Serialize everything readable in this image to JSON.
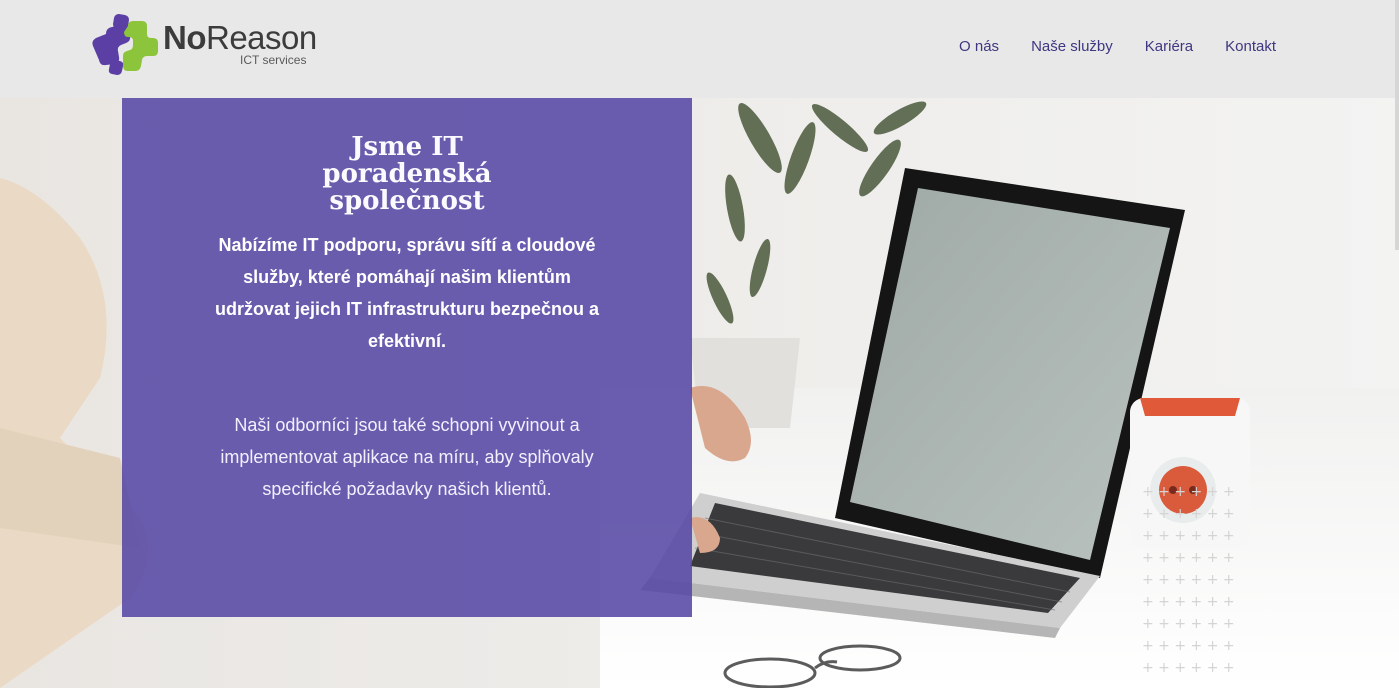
{
  "brand": {
    "name_bold": "No",
    "name_rest": "Reason",
    "tagline": "ICT services",
    "colors": {
      "purple": "#5b3fa4",
      "green": "#8cc43c"
    }
  },
  "nav": {
    "items": [
      {
        "label": "O nás"
      },
      {
        "label": "Naše služby"
      },
      {
        "label": "Kariéra"
      },
      {
        "label": "Kontakt"
      }
    ],
    "color": "#3e3780"
  },
  "hero": {
    "title": "Jsme IT poradenská společnost",
    "lead": "Nabízíme IT podporu, správu sítí a cloudové služby, které pomáhají našim klientům udržovat jejich IT infrastrukturu bezpečnou a efektivní.",
    "body": "Naši odborníci jsou také schopni vyvinout a implementovat aplikace na míru, aby splňovaly specifické požadavky našich klientů.",
    "panel_color": "#5748a5",
    "image": "laptop-workspace-photo"
  }
}
